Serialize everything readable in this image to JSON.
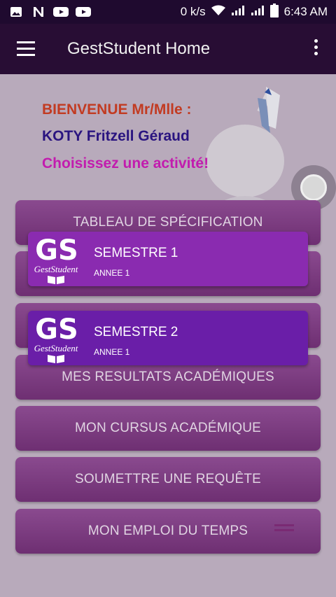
{
  "status_bar": {
    "network_speed": "0 k/s",
    "time": "6:43 AM"
  },
  "app_bar": {
    "title": "GestStudent Home"
  },
  "welcome": {
    "line1": "BIENVENUE Mr/Mlle :",
    "line2": "KOTY Fritzell Géraud",
    "line3": "Choisissez une activité!"
  },
  "menu": [
    "TABLEAU DE SPÉCIFICATION",
    "",
    "",
    "MES RESULTATS ACADÉMIQUES",
    "MON CURSUS ACADÉMIQUE",
    "SOUMETTRE UNE REQUÊTE",
    "MON EMPLOI DU TEMPS"
  ],
  "cards": [
    {
      "logo_text": "GS",
      "logo_caption": "GestStudent",
      "title": "SEMESTRE 1",
      "subtitle": "ANNEE 1"
    },
    {
      "logo_text": "GS",
      "logo_caption": "GestStudent",
      "title": "SEMESTRE 2",
      "subtitle": "ANNEE 1"
    }
  ],
  "colors": {
    "app_bar": "#280d34",
    "card1": "#8a2bb0",
    "card2": "#6a1ea8",
    "menu_button": "#7c3d80"
  },
  "icons": [
    "image-icon",
    "n-app-icon",
    "youtube-icon",
    "youtube-icon",
    "wifi-icon",
    "signal-icon",
    "signal-icon",
    "battery-icon",
    "hamburger-menu-icon",
    "overflow-menu-icon",
    "floating-action-icon"
  ]
}
